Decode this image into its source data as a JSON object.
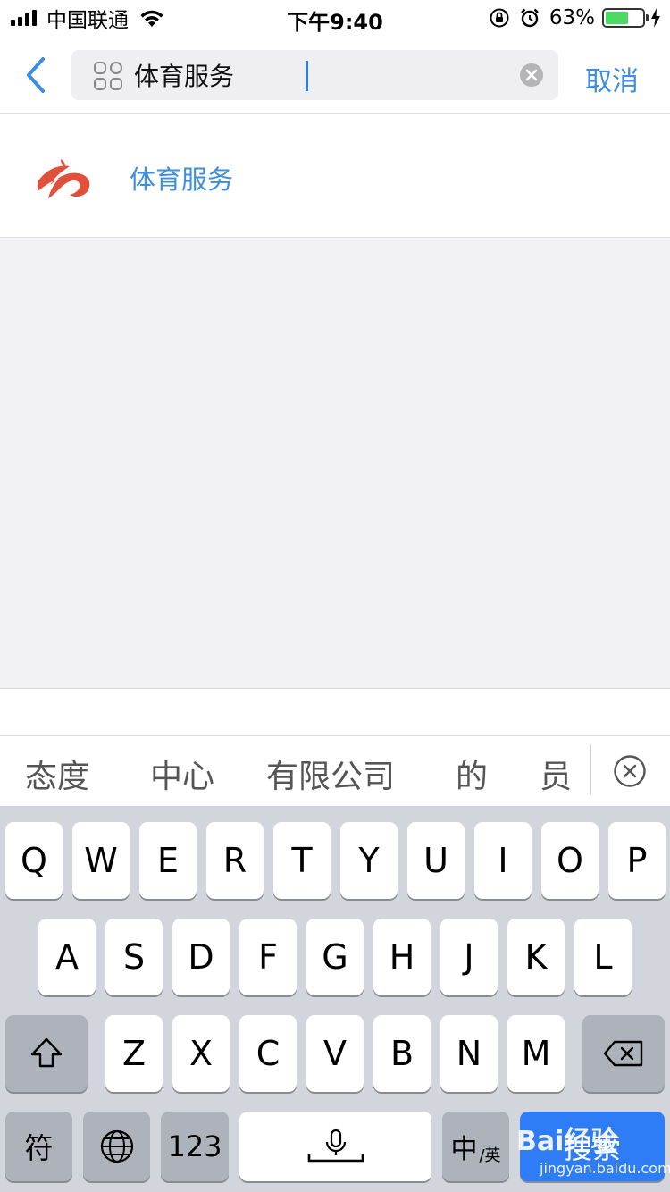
{
  "status_bar": {
    "carrier": "中国联通",
    "time": "下午9:40",
    "battery_percent": "63%",
    "battery_level": 0.63,
    "icons": [
      "signal-icon",
      "wifi-icon",
      "rotation-lock-icon",
      "alarm-icon",
      "battery-icon",
      "charging-icon"
    ]
  },
  "nav": {
    "back_icon": "chevron-left-icon",
    "search_value": "体育服务",
    "search_icon": "grid-apps-icon",
    "clear_icon": "clear-circle-icon",
    "cancel_label": "取消"
  },
  "results": [
    {
      "label": "体育服务",
      "icon": "sports-service-logo"
    }
  ],
  "candidates": [
    "态度",
    "中心",
    "有限公司",
    "的",
    "员"
  ],
  "keyboard": {
    "row1": [
      "Q",
      "W",
      "E",
      "R",
      "T",
      "Y",
      "U",
      "I",
      "O",
      "P"
    ],
    "row2": [
      "A",
      "S",
      "D",
      "F",
      "G",
      "H",
      "J",
      "K",
      "L"
    ],
    "row3": [
      "Z",
      "X",
      "C",
      "V",
      "B",
      "N",
      "M"
    ],
    "symbol_label": "符",
    "numbers_label": "123",
    "lang_main": "中",
    "lang_sub": "/英",
    "search_label": "搜索"
  },
  "watermark": {
    "text": "Bai经验",
    "url": "jingyan.baidu.com"
  },
  "colors": {
    "accent": "#3b8ee0",
    "logo_red": "#e0503a",
    "search_key": "#2f7df6"
  }
}
